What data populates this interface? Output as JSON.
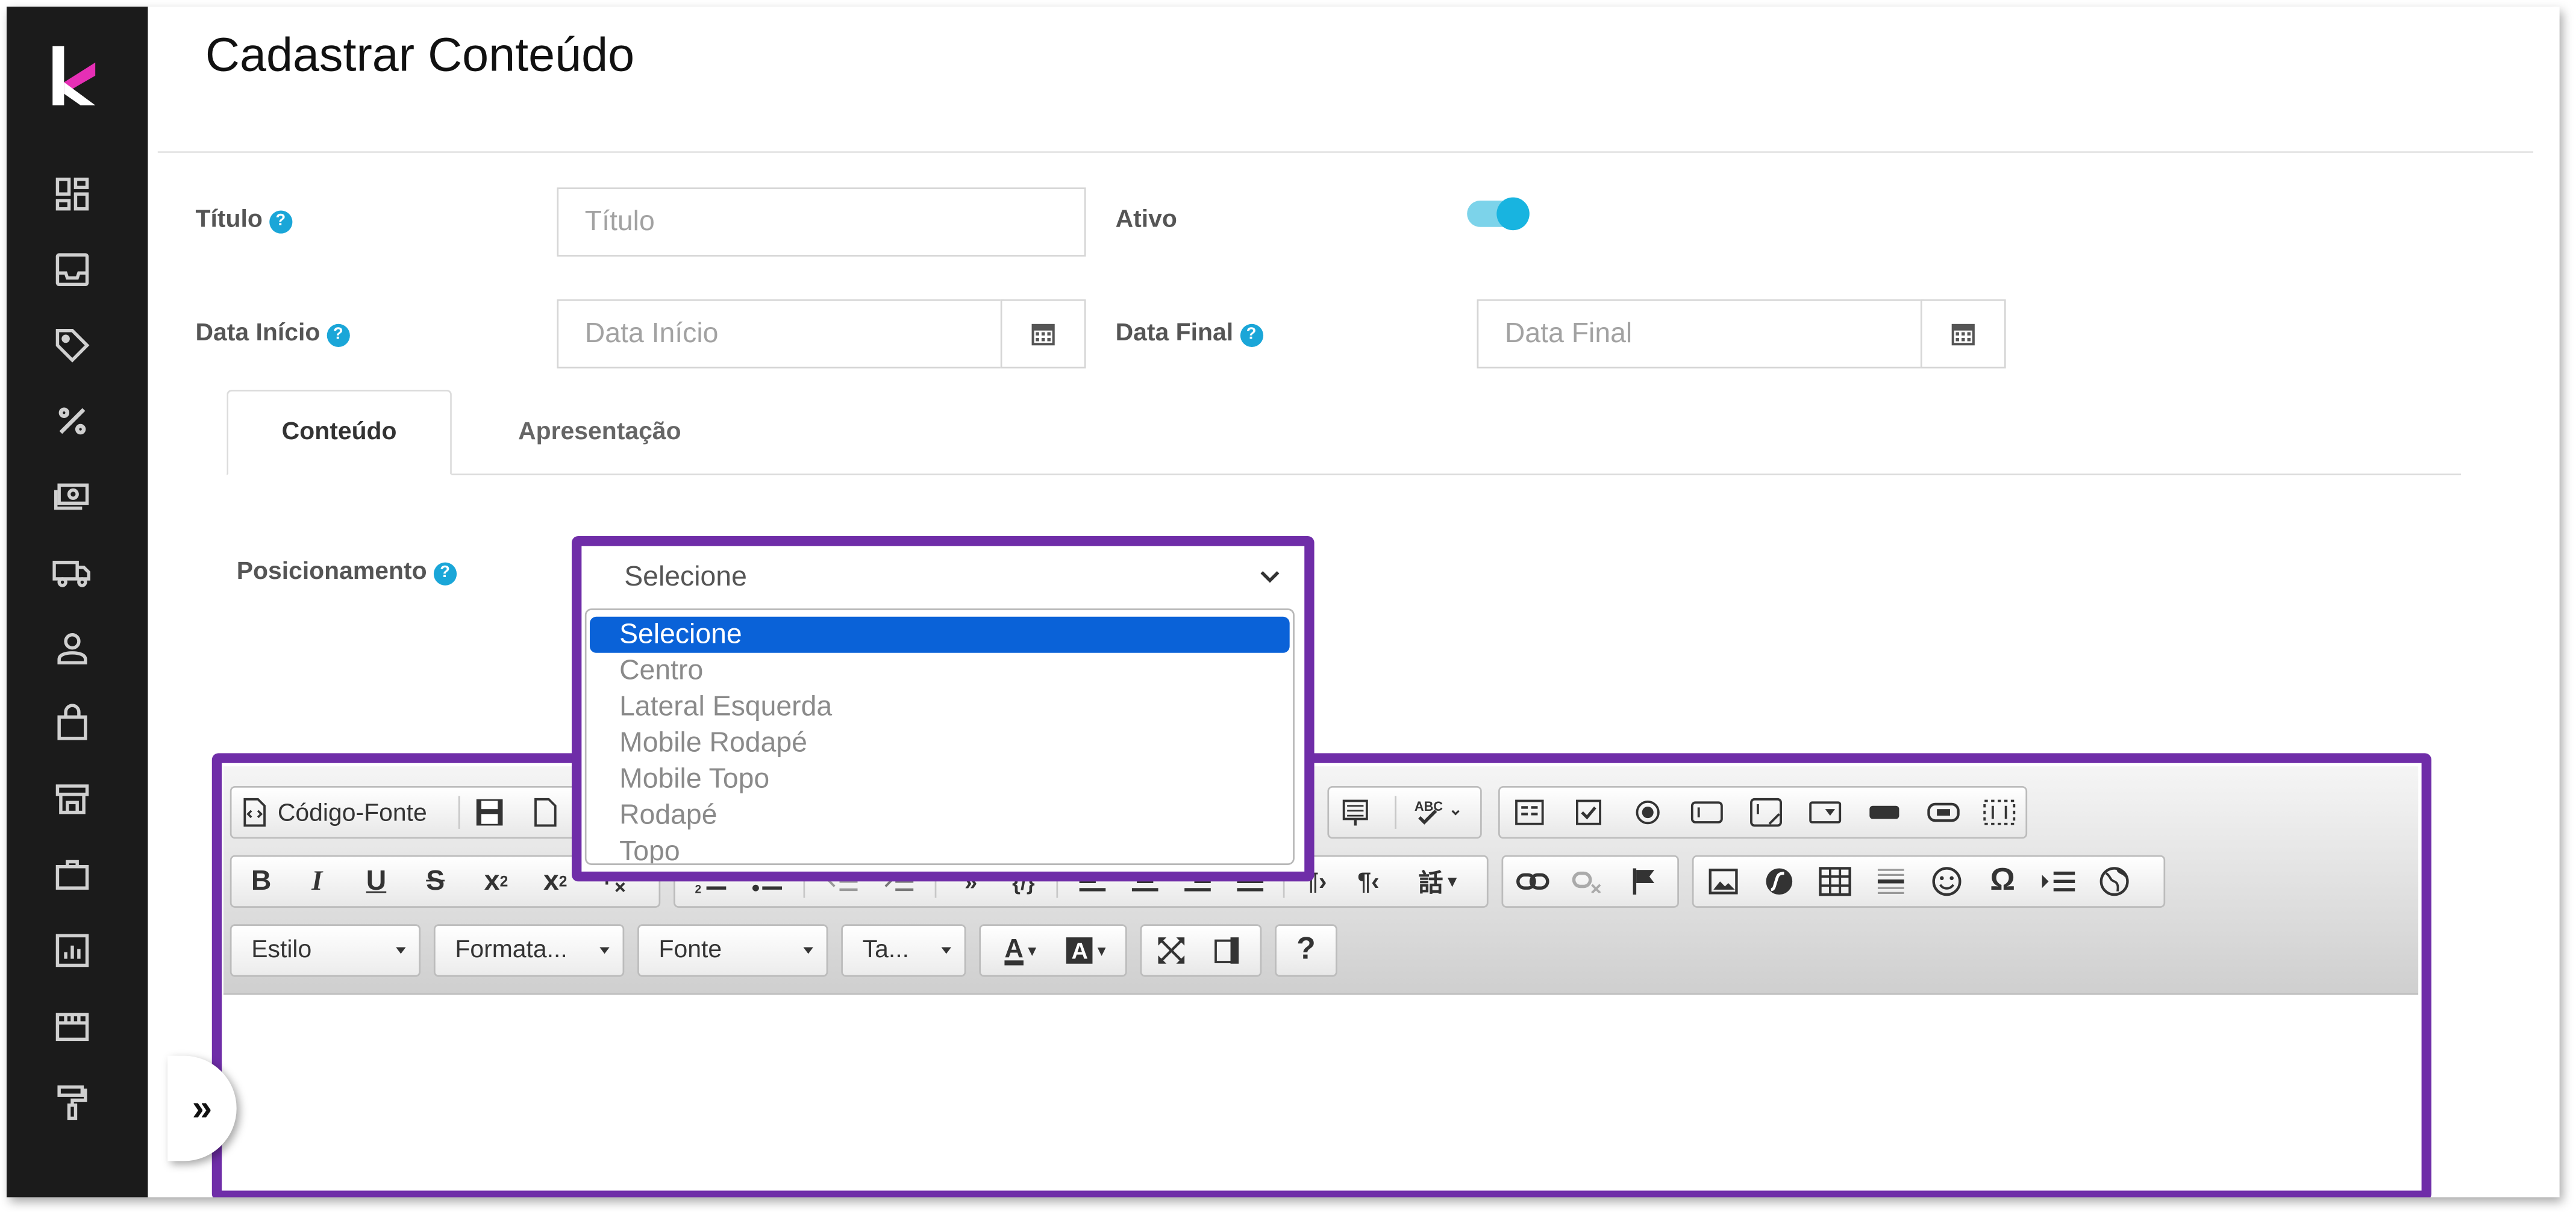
{
  "page_title": "Cadastrar Conteúdo",
  "form": {
    "titulo_label": "Título",
    "titulo_placeholder": "Título",
    "ativo_label": "Ativo",
    "ativo_on": true,
    "data_inicio_label": "Data Início",
    "data_inicio_placeholder": "Data Início",
    "data_final_label": "Data Final",
    "data_final_placeholder": "Data Final",
    "posicionamento_label": "Posicionamento"
  },
  "tabs": [
    {
      "label": "Conteúdo",
      "active": true
    },
    {
      "label": "Apresentação",
      "active": false
    }
  ],
  "posicionamento": {
    "selected": "Selecione",
    "options": [
      "Selecione",
      "Centro",
      "Lateral Esquerda",
      "Mobile Rodapé",
      "Mobile Topo",
      "Rodapé",
      "Topo"
    ]
  },
  "editor": {
    "source_label": "Código-Fonte",
    "combos": {
      "estilo": "Estilo",
      "formatacao": "Formata...",
      "fonte": "Fonte",
      "tamanho": "Ta..."
    },
    "help_label": "?"
  },
  "sidebar_icons": [
    "dashboard-icon",
    "inbox-icon",
    "tag-icon",
    "percent-icon",
    "money-icon",
    "truck-icon",
    "user-icon",
    "shopping-bag-icon",
    "store-icon",
    "briefcase-icon",
    "report-icon",
    "storefront-icon",
    "paint-roller-icon"
  ],
  "expand_label": "»",
  "colors": {
    "sidebar": "#1b1b1b",
    "accent": "#1aa6d8",
    "highlight": "#6f2da8",
    "selected_option": "#0a62d8",
    "logo_pink": "#e62fb5"
  }
}
